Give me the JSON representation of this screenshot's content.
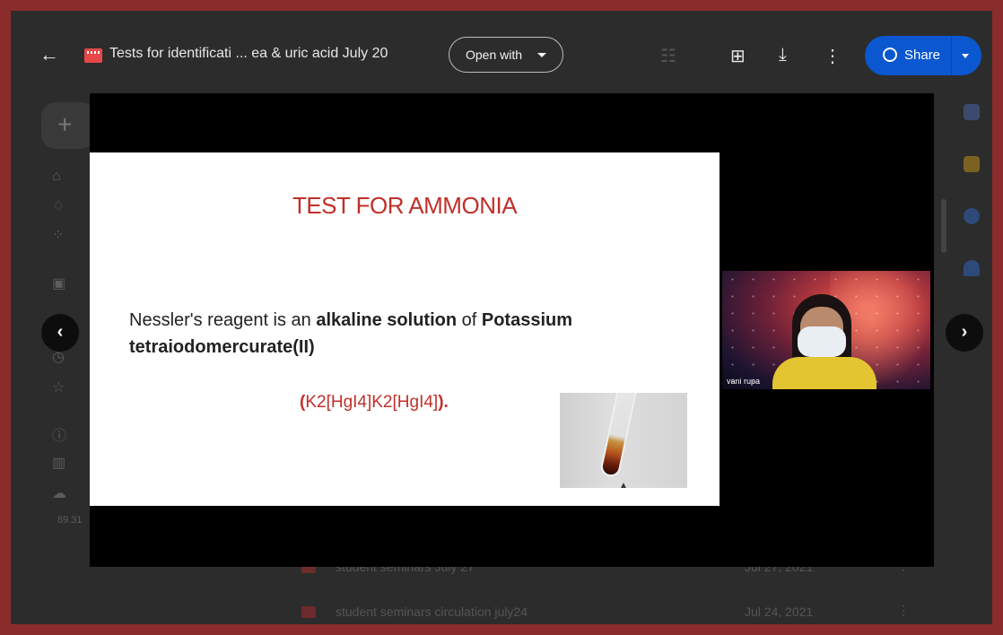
{
  "app": {
    "title": "Tests for identificati ... ea & uric acid July 20",
    "open_with_label": "Open with",
    "share_label": "Share"
  },
  "slide": {
    "heading": "TEST FOR AMMONIA",
    "body_prefix": "Nessler's reagent is an ",
    "body_bold1": "alkaline solution",
    "body_mid": " of ",
    "body_bold2": "Potassium tetraiodomercurate(II)",
    "formula_open": "(",
    "formula_text": "K2[HgI4]K2[HgI4]",
    "formula_close": ").",
    "accent_color": "#c0302a"
  },
  "participant": {
    "name": "vani rupa"
  },
  "background": {
    "storage_text": "89.31",
    "rows": [
      {
        "name": "student seminars July 27",
        "date": "Jul 27, 2021"
      },
      {
        "name": "student seminars circulation  july24",
        "date": "Jul 24, 2021"
      }
    ]
  },
  "icons": {
    "back": "arrow-left-icon",
    "add_comment": "add-comment-icon",
    "download": "download-icon",
    "more": "more-vert-icon",
    "share_globe": "globe-icon",
    "prev": "chevron-left-icon",
    "next": "chevron-right-icon"
  },
  "colors": {
    "frame_border": "#8b2c2c",
    "share_button": "#0b57d0",
    "overlay": "#2c2c2c"
  }
}
